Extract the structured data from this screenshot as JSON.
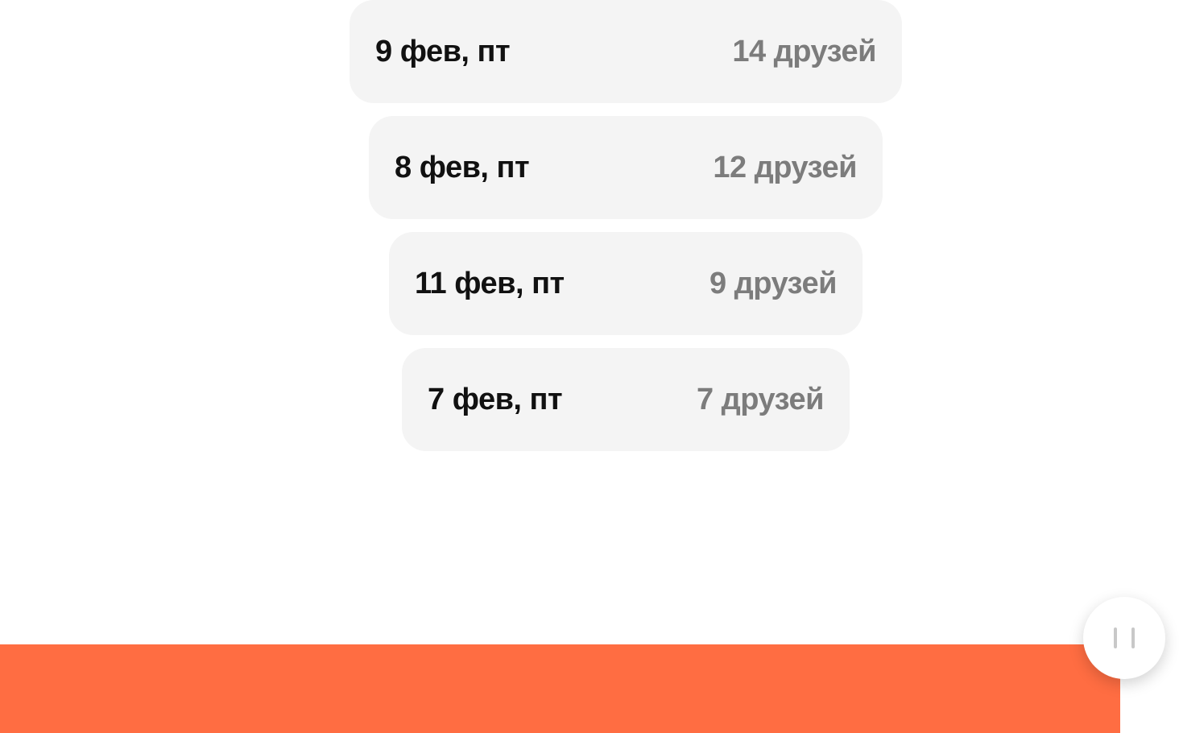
{
  "cards": [
    {
      "date": "9 фев, пт",
      "friends": "14 друзей"
    },
    {
      "date": "8 фев, пт",
      "friends": "12 друзей"
    },
    {
      "date": "11 фев, пт",
      "friends": "9 друзей"
    },
    {
      "date": "7 фев, пт",
      "friends": "7 друзей"
    }
  ],
  "pause_button": {
    "icon": "pause-icon"
  },
  "colors": {
    "accent": "#ff6d42",
    "card_bg": "#f4f4f4",
    "muted_text": "#7c7c7c"
  }
}
